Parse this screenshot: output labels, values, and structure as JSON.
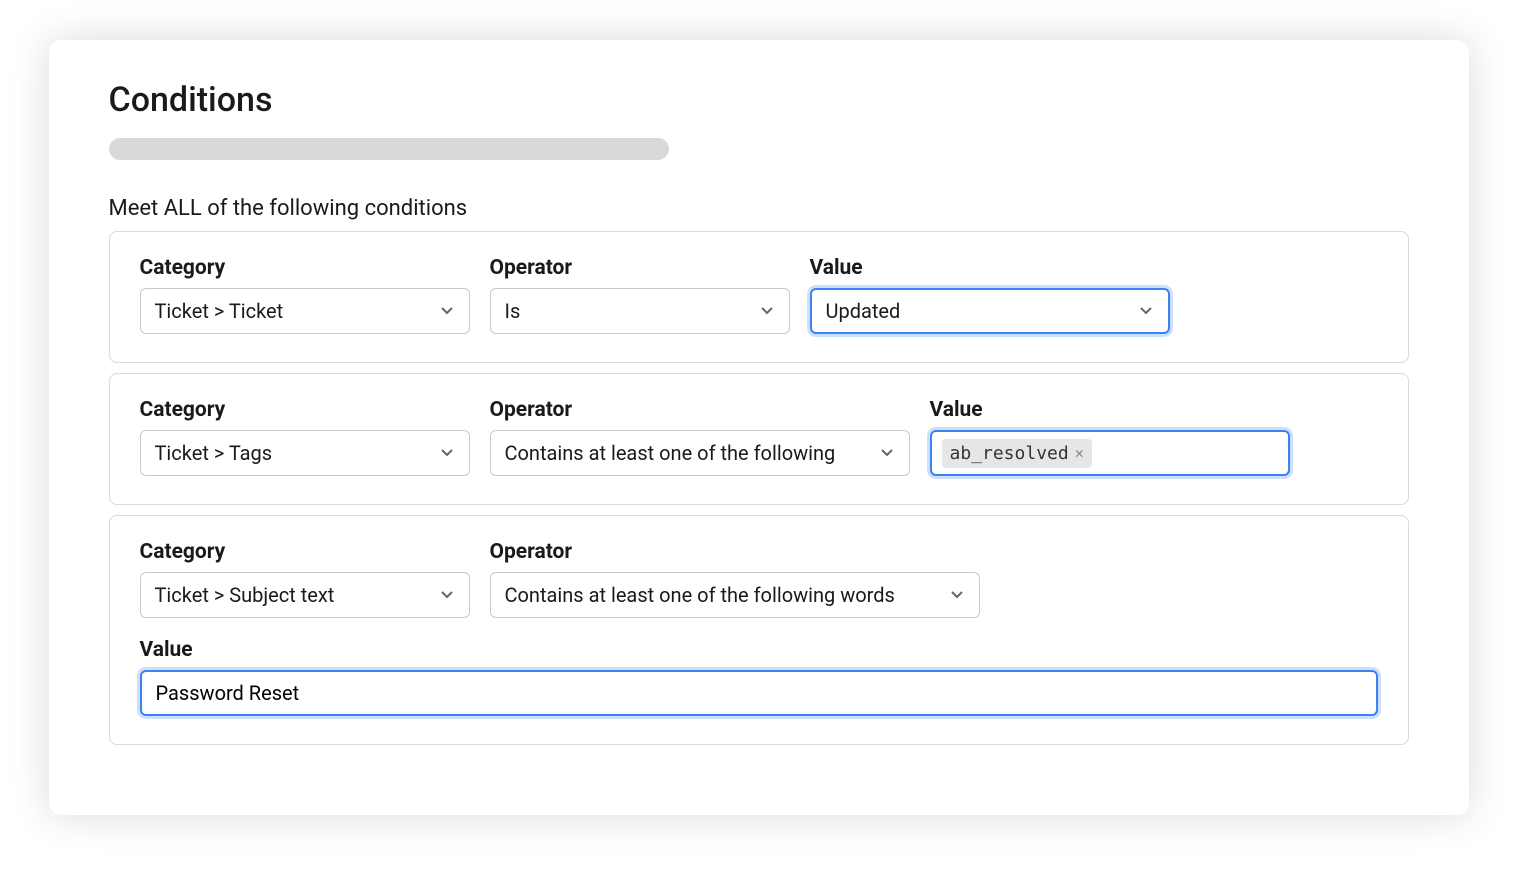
{
  "title": "Conditions",
  "section_label": "Meet ALL of the following conditions",
  "labels": {
    "category": "Category",
    "operator": "Operator",
    "value": "Value"
  },
  "conditions": [
    {
      "category": "Ticket > Ticket",
      "operator": "Is",
      "value": "Updated"
    },
    {
      "category": "Ticket > Tags",
      "operator": "Contains at least one of the following",
      "tags": [
        "ab_resolved"
      ]
    },
    {
      "category": "Ticket > Subject text",
      "operator": "Contains at least one of the following words",
      "value": "Password Reset"
    }
  ]
}
